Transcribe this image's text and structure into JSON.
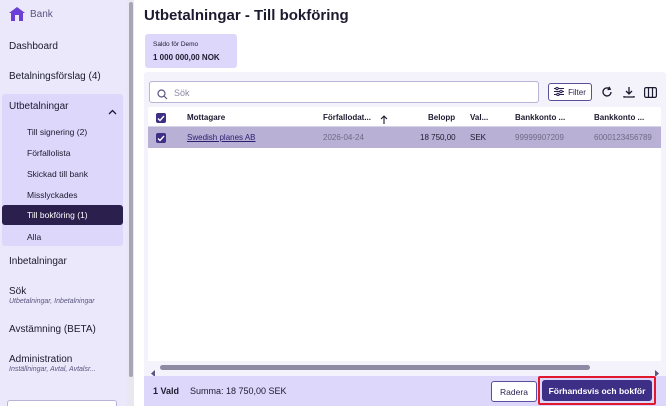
{
  "brand": {
    "name": "Bank",
    "icon": "house-icon"
  },
  "sidebar": {
    "dashboard": "Dashboard",
    "betalningsforslag": "Betalningsförslag (4)",
    "utbetalningar": {
      "label": "Utbetalningar",
      "items": [
        {
          "label": "Till signering (2)"
        },
        {
          "label": "Förfallolista"
        },
        {
          "label": "Skickad till bank"
        },
        {
          "label": "Misslyckades"
        },
        {
          "label": "Till bokföring (1)",
          "active": true
        },
        {
          "label": "Alla"
        }
      ]
    },
    "inbetalningar": "Inbetalningar",
    "sok": {
      "label": "Sök",
      "sub": "Utbetalningar, Inbetalningar"
    },
    "avstamning": "Avstämning (BETA)",
    "administration": {
      "label": "Administration",
      "sub": "Inställningar, Avtal, Avtalsr..."
    }
  },
  "main": {
    "title": "Utbetalningar - Till bokföring",
    "saldo": {
      "label": "Saldo för Demo",
      "value": "1 000 000,00 NOK"
    },
    "search": {
      "placeholder": "Sök"
    },
    "toolbar": {
      "filter_label": "Filter"
    },
    "table": {
      "columns": [
        "Mottagare",
        "Förfallodat...",
        "Belopp",
        "Val...",
        "Bankkonto ...",
        "Bankkonto ..."
      ],
      "sort_column": "Förfallodat...",
      "sort_direction": "ascending",
      "rows": [
        {
          "selected": true,
          "mottagare": "Swedish planes AB",
          "forfallodatum": "2026-04-24",
          "belopp": "18 750,00",
          "valuta": "SEK",
          "bankkonto1": "99999907209",
          "bankkonto2": "6000123456789"
        }
      ]
    },
    "footer": {
      "count": "1 Vald",
      "sum": "Summa: 18 750,00 SEK",
      "delete_label": "Radera",
      "primary_label": "Förhandsvis och bokför"
    }
  },
  "colors": {
    "accent": "#3d2f86",
    "sidebar_bg": "#ebe8fb",
    "highlight": "#e0192c"
  }
}
